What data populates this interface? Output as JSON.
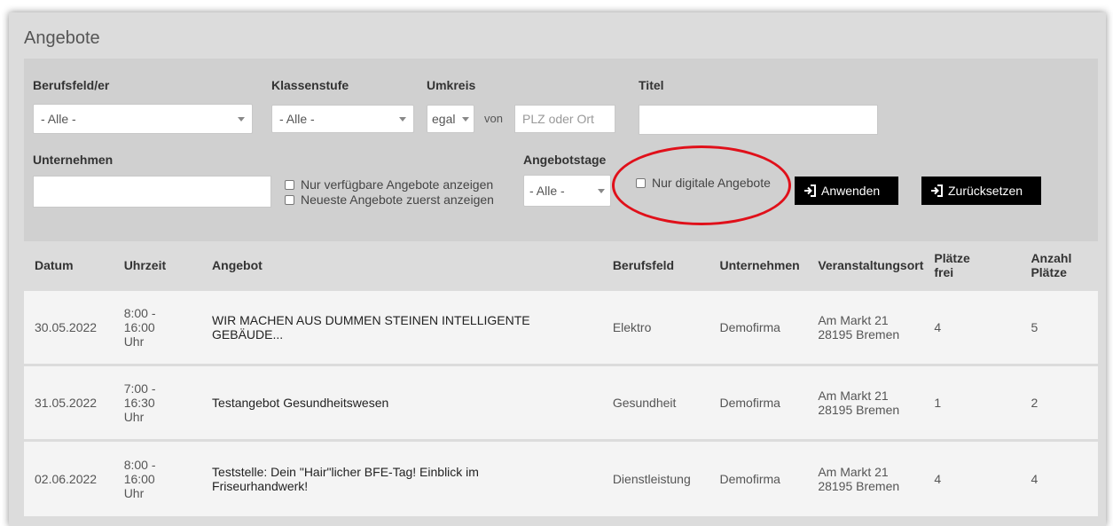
{
  "panel_title": "Angebote",
  "filters": {
    "berufsfeld_label": "Berufsfeld/er",
    "berufsfeld_value": "- Alle -",
    "klassenstufe_label": "Klassenstufe",
    "klassenstufe_value": "- Alle -",
    "umkreis_label": "Umkreis",
    "umkreis_value": "egal",
    "von_label": "von",
    "plz_placeholder": "PLZ oder Ort",
    "titel_label": "Titel",
    "titel_value": "",
    "unternehmen_label": "Unternehmen",
    "unternehmen_value": "",
    "cb_verfuegbar": "Nur verfügbare Angebote anzeigen",
    "cb_neueste": "Neueste Angebote zuerst anzeigen",
    "angebotstage_label": "Angebotstage",
    "angebotstage_value": "- Alle -",
    "cb_digital": "Nur digitale Angebote",
    "apply_button": "Anwenden",
    "reset_button": "Zurücksetzen",
    "highlight_color": "#e0101a"
  },
  "table": {
    "headers": {
      "datum": "Datum",
      "uhrzeit": "Uhrzeit",
      "angebot": "Angebot",
      "berufsfeld": "Berufsfeld",
      "unternehmen": "Unternehmen",
      "ort": "Veranstaltungsort",
      "frei_1": "Plätze",
      "frei_2": "frei",
      "anzahl_1": "Anzahl",
      "anzahl_2": "Plätze"
    },
    "rows": [
      {
        "datum": "30.05.2022",
        "zeit_1": "8:00 -",
        "zeit_2": "16:00",
        "zeit_3": "Uhr",
        "angebot_1": "WIR MACHEN AUS DUMMEN STEINEN INTELLIGENTE",
        "angebot_2": "GEBÄUDE...",
        "berufsfeld": "Elektro",
        "unternehmen": "Demofirma",
        "ort_1": "Am Markt 21",
        "ort_2": "28195 Bremen",
        "frei": "4",
        "anzahl": "5"
      },
      {
        "datum": "31.05.2022",
        "zeit_1": "7:00 -",
        "zeit_2": "16:30",
        "zeit_3": "Uhr",
        "angebot_1": "Testangebot Gesundheitswesen",
        "angebot_2": "",
        "berufsfeld": "Gesundheit",
        "unternehmen": "Demofirma",
        "ort_1": "Am Markt 21",
        "ort_2": "28195 Bremen",
        "frei": "1",
        "anzahl": "2"
      },
      {
        "datum": "02.06.2022",
        "zeit_1": "8:00 -",
        "zeit_2": "16:00",
        "zeit_3": "Uhr",
        "angebot_1": "Teststelle: Dein \"Hair\"licher BFE-Tag! Einblick im",
        "angebot_2": "Friseurhandwerk!",
        "berufsfeld": "Dienstleistung",
        "unternehmen": "Demofirma",
        "ort_1": "Am Markt 21",
        "ort_2": "28195 Bremen",
        "frei": "4",
        "anzahl": "4"
      }
    ]
  }
}
